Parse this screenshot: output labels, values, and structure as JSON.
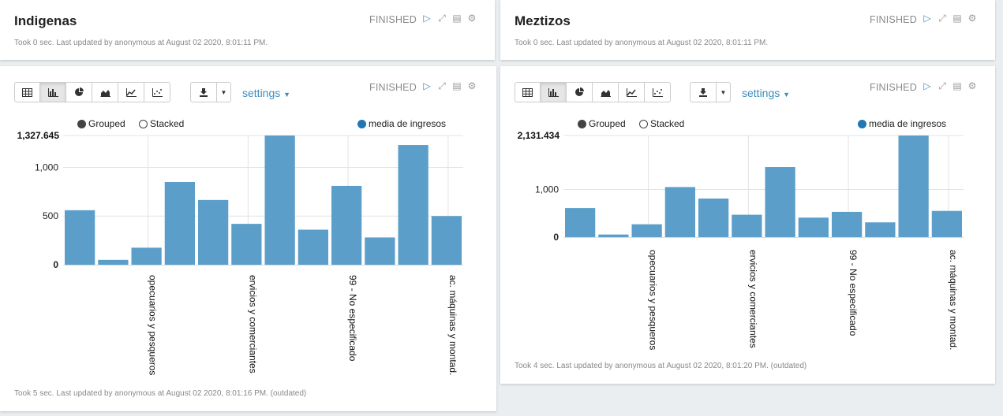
{
  "panels": {
    "indigenas": {
      "title": "Indigenas",
      "status": "FINISHED",
      "meta": "Took 0 sec. Last updated by anonymous at August 02 2020, 8:01:11 PM."
    },
    "meztizos": {
      "title": "Meztizos",
      "status": "FINISHED",
      "meta": "Took 0 sec. Last updated by anonymous at August 02 2020, 8:01:11 PM."
    },
    "chart_left": {
      "status": "FINISHED",
      "settings_label": "settings",
      "meta": "Took 5 sec. Last updated by anonymous at August 02 2020, 8:01:16 PM. (outdated)"
    },
    "chart_right": {
      "status": "FINISHED",
      "settings_label": "settings",
      "meta": "Took 4 sec. Last updated by anonymous at August 02 2020, 8:01:20 PM. (outdated)"
    }
  },
  "legend": {
    "grouped": "Grouped",
    "stacked": "Stacked",
    "series": "media de ingresos"
  },
  "colors": {
    "bar": "#5b9ec9",
    "accent": "#3c8dbc"
  },
  "chart_data": [
    {
      "type": "bar",
      "series": [
        {
          "name": "media de ingresos",
          "values": [
            560,
            50,
            175,
            850,
            665,
            420,
            1327.645,
            360,
            810,
            280,
            1230,
            500
          ]
        }
      ],
      "category_labels": [
        "",
        "",
        "opecuarios y pesqueros",
        "",
        "",
        "ervicios y comerciantes",
        "",
        "",
        "99 - No especificado",
        "",
        "",
        "ac. máquinas y montad."
      ],
      "ylim": [
        0,
        1327.645
      ],
      "yticks": [
        0,
        500,
        1000
      ],
      "ytick_labels": [
        "0",
        "500",
        "1,000"
      ],
      "ymax_label": "1,327.645",
      "grid": true
    },
    {
      "type": "bar",
      "series": [
        {
          "name": "media de ingresos",
          "values": [
            610,
            55,
            270,
            1050,
            810,
            470,
            1470,
            410,
            530,
            310,
            2131.434,
            550
          ]
        }
      ],
      "category_labels": [
        "",
        "",
        "opecuarios y pesqueros",
        "",
        "",
        "ervicios y comerciantes",
        "",
        "",
        "99 - No especificado",
        "",
        "",
        "ac. máquinas y montad."
      ],
      "ylim": [
        0,
        2131.434
      ],
      "yticks": [
        0,
        1000
      ],
      "ytick_labels": [
        "0",
        "1,000"
      ],
      "ymax_label": "2,131.434",
      "grid": true
    }
  ]
}
